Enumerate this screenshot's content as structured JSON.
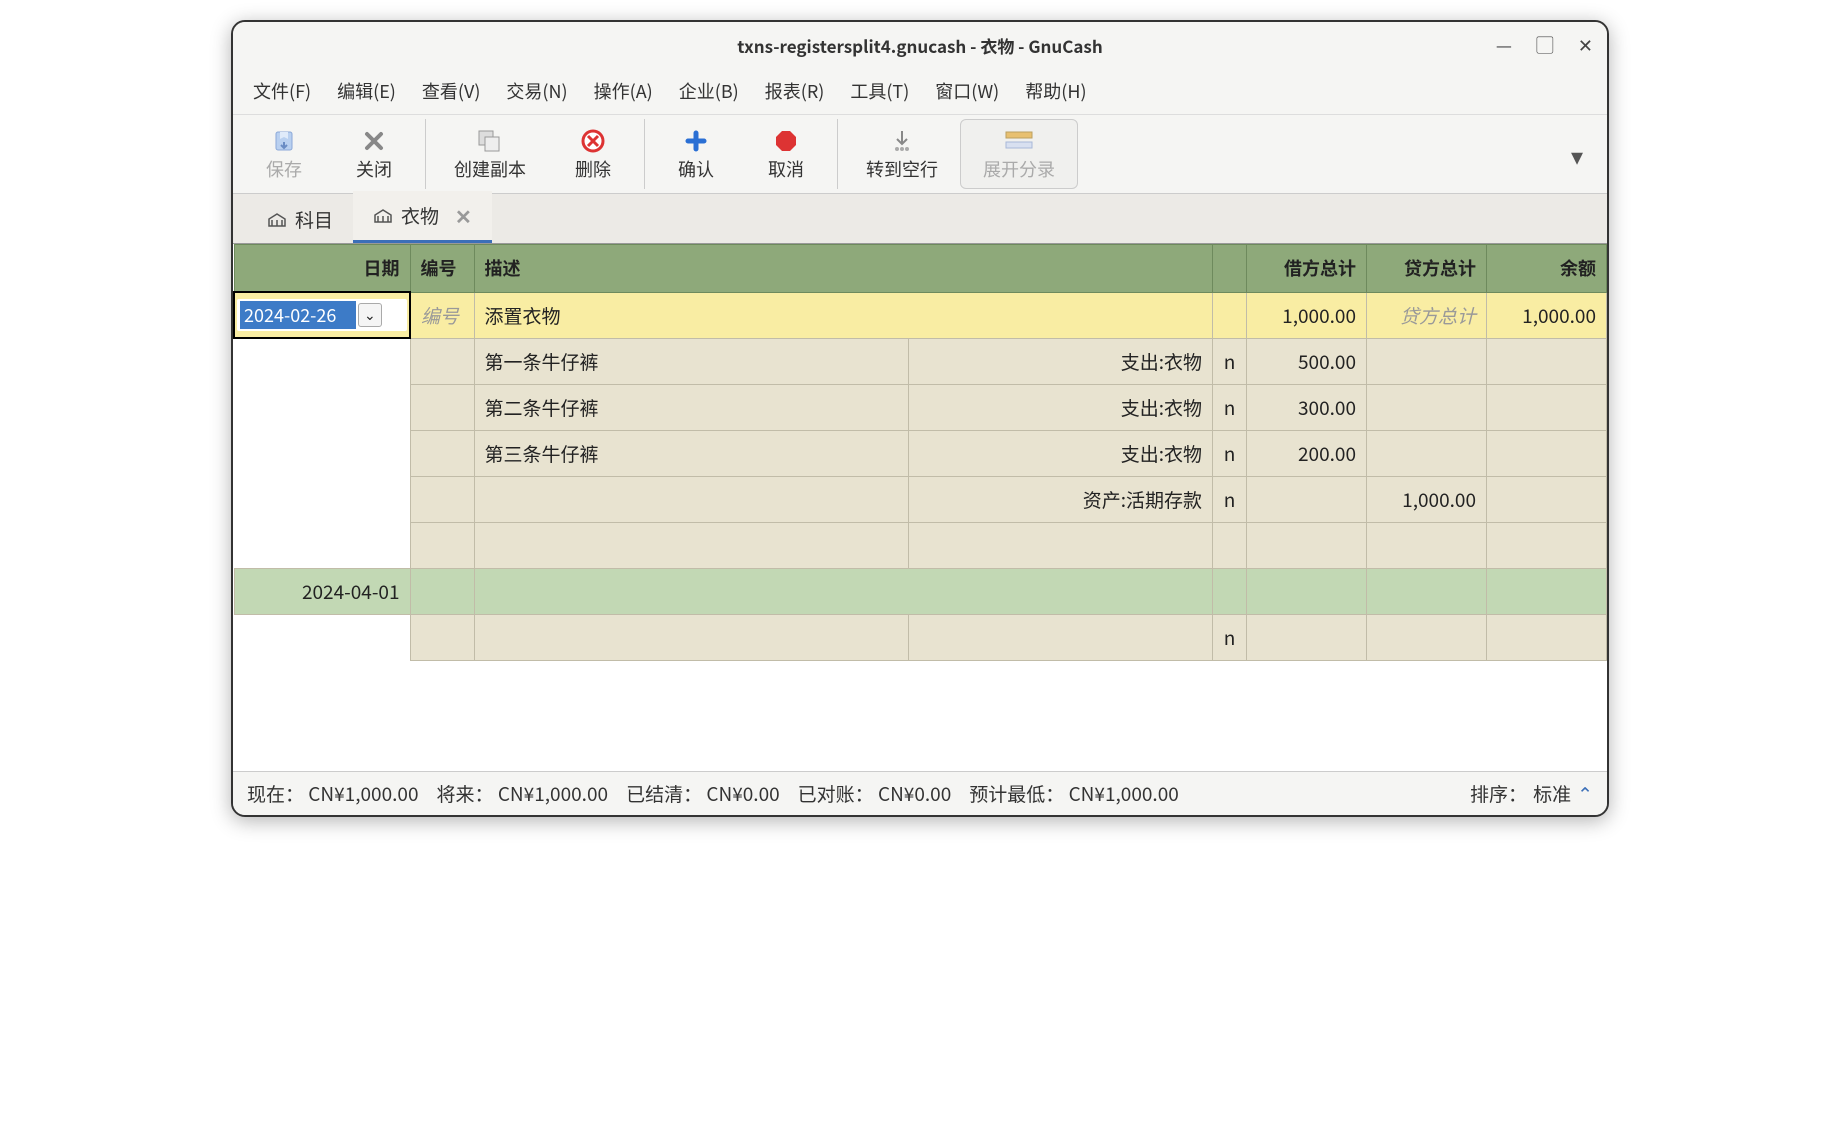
{
  "window": {
    "title": "txns-registersplit4.gnucash - 衣物 - GnuCash"
  },
  "menu": {
    "file": "文件(F)",
    "edit": "编辑(E)",
    "view": "查看(V)",
    "transaction": "交易(N)",
    "actions": "操作(A)",
    "business": "企业(B)",
    "reports": "报表(R)",
    "tools": "工具(T)",
    "windows": "窗口(W)",
    "help": "帮助(H)"
  },
  "toolbar": {
    "save": "保存",
    "close": "关闭",
    "duplicate": "创建副本",
    "delete": "删除",
    "enter": "确认",
    "cancel": "取消",
    "blank": "转到空行",
    "split": "展开分录"
  },
  "tabs": {
    "accounts": "科目",
    "clothing": "衣物"
  },
  "headers": {
    "date": "日期",
    "num": "编号",
    "desc": "描述",
    "debit": "借方总计",
    "credit": "贷方总计",
    "balance": "余额"
  },
  "rows": {
    "main": {
      "date": "2024-02-26",
      "num_placeholder": "编号",
      "desc": "添置衣物",
      "debit": "1,000.00",
      "credit_placeholder": "贷方总计",
      "balance": "1,000.00"
    },
    "splits": [
      {
        "desc": "第一条牛仔裤",
        "account": "支出:衣物",
        "r": "n",
        "debit": "500.00",
        "credit": ""
      },
      {
        "desc": "第二条牛仔裤",
        "account": "支出:衣物",
        "r": "n",
        "debit": "300.00",
        "credit": ""
      },
      {
        "desc": "第三条牛仔裤",
        "account": "支出:衣物",
        "r": "n",
        "debit": "200.00",
        "credit": ""
      },
      {
        "desc": "",
        "account": "资产:活期存款",
        "r": "n",
        "debit": "",
        "credit": "1,000.00"
      },
      {
        "desc": "",
        "account": "",
        "r": "",
        "debit": "",
        "credit": ""
      }
    ],
    "next": {
      "date": "2024-04-01",
      "r": "n"
    }
  },
  "status": {
    "present_label": "现在：",
    "present_value": "CN¥1,000.00",
    "future_label": "将来：",
    "future_value": "CN¥1,000.00",
    "cleared_label": "已结清：",
    "cleared_value": "CN¥0.00",
    "reconciled_label": "已对账：",
    "reconciled_value": "CN¥0.00",
    "minimum_label": "预计最低：",
    "minimum_value": "CN¥1,000.00",
    "sort_label": "排序：",
    "sort_value": "标准"
  }
}
